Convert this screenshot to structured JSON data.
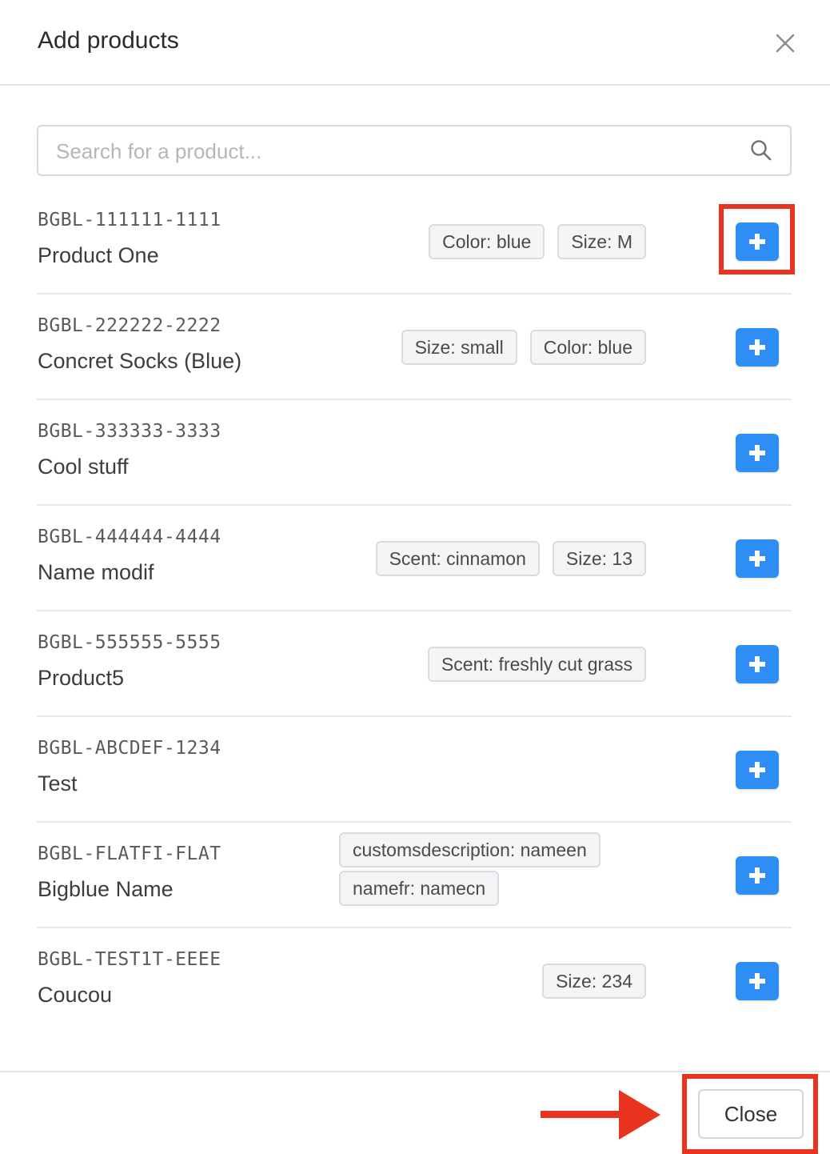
{
  "modal": {
    "title": "Add products",
    "close_icon": "close-icon"
  },
  "search": {
    "placeholder": "Search for a product...",
    "value": "",
    "icon": "search-icon"
  },
  "products": [
    {
      "sku": "BGBL-111111-1111",
      "name": "Product One",
      "tags": [
        "Color: blue",
        "Size: M"
      ]
    },
    {
      "sku": "BGBL-222222-2222",
      "name": "Concret Socks (Blue)",
      "tags": [
        "Size: small",
        "Color: blue"
      ]
    },
    {
      "sku": "BGBL-333333-3333",
      "name": "Cool stuff",
      "tags": []
    },
    {
      "sku": "BGBL-444444-4444",
      "name": "Name modif",
      "tags": [
        "Scent: cinnamon",
        "Size: 13"
      ]
    },
    {
      "sku": "BGBL-555555-5555",
      "name": "Product5",
      "tags": [
        "Scent: freshly cut grass"
      ]
    },
    {
      "sku": "BGBL-ABCDEF-1234",
      "name": "Test",
      "tags": []
    },
    {
      "sku": "BGBL-FLATFI-FLAT",
      "name": "Bigblue Name",
      "tags": [
        "customsdescription: nameen",
        "namefr: namecn"
      ]
    },
    {
      "sku": "BGBL-TEST1T-EEEE",
      "name": "Coucou",
      "tags": [
        "Size: 234"
      ]
    }
  ],
  "add_button_icon": "plus-icon",
  "footer": {
    "close_label": "Close"
  },
  "colors": {
    "accent": "#2f8ef5",
    "annotation": "#e8331f"
  }
}
